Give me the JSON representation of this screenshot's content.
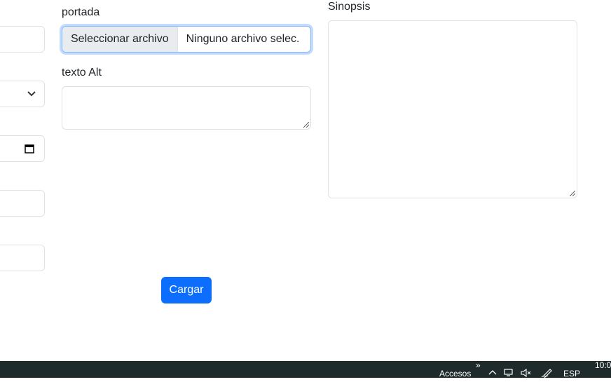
{
  "form": {
    "portada_label": "portada",
    "file_button_label": "Seleccionar archivo",
    "file_status": "Ninguno archivo selec.",
    "alt_label": "texto Alt",
    "sinopsis_label": "Sinopsis",
    "submit_label": "Cargar"
  },
  "taskbar": {
    "accesos_label": "Accesos",
    "overflow_glyph": "»",
    "language": "ESP",
    "time": "10:0"
  },
  "colors": {
    "primary": "#0d6efd",
    "focus_border": "#86b7fe",
    "taskbar_bg": "#1f2a2a"
  }
}
